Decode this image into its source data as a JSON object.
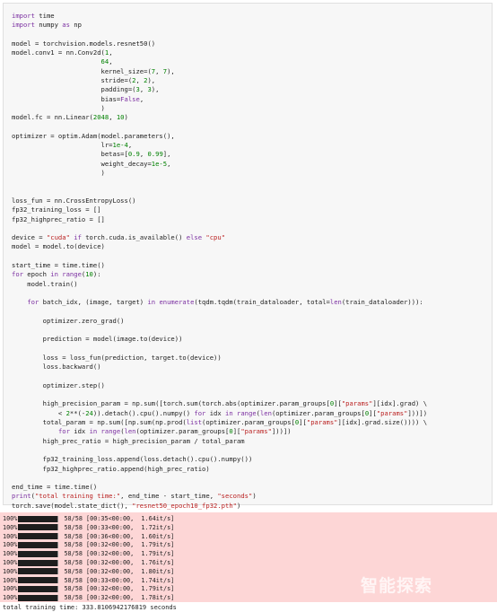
{
  "code_lines": [
    "import time",
    "import numpy as np",
    "",
    "model = torchvision.models.resnet50()",
    "model.conv1 = nn.Conv2d(1,",
    "                       64,",
    "                       kernel_size=(7, 7),",
    "                       stride=(2, 2),",
    "                       padding=(3, 3),",
    "                       bias=False,",
    "                       )",
    "model.fc = nn.Linear(2048, 10)",
    "",
    "optimizer = optim.Adam(model.parameters(),",
    "                       lr=1e-4,",
    "                       betas=[0.9, 0.99],",
    "                       weight_decay=1e-5,",
    "                       )",
    "",
    "",
    "loss_fun = nn.CrossEntropyLoss()",
    "fp32_training_loss = []",
    "fp32_highprec_ratio = []",
    "",
    "device = \"cuda\" if torch.cuda.is_available() else \"cpu\"",
    "model = model.to(device)",
    "",
    "start_time = time.time()",
    "for epoch in range(10):",
    "    model.train()",
    "",
    "    for batch_idx, (image, target) in enumerate(tqdm.tqdm(train_dataloader, total=len(train_dataloader))):",
    "",
    "        optimizer.zero_grad()",
    "",
    "        prediction = model(image.to(device))",
    "",
    "        loss = loss_fun(prediction, target.to(device))",
    "        loss.backward()",
    "",
    "        optimizer.step()",
    "",
    "        high_precision_param = np.sum([torch.sum(torch.abs(optimizer.param_groups[0][\"params\"][idx].grad) \\",
    "            < 2**(-24)).detach().cpu().numpy() for idx in range(len(optimizer.param_groups[0][\"params\"]))])",
    "        total_param = np.sum([np.sum(np.prod(list(optimizer.param_groups[0][\"params\"][idx].grad.size()))) \\",
    "            for idx in range(len(optimizer.param_groups[0][\"params\"]))])",
    "        high_prec_ratio = high_precision_param / total_param",
    "",
    "        fp32_training_loss.append(loss.detach().cpu().numpy())",
    "        fp32_highprec_ratio.append(high_prec_ratio)",
    "",
    "end_time = time.time()",
    "print(\"total training time:\", end_time - start_time, \"seconds\")",
    "torch.save(model.state_dict(), \"resnet50_epoch10_fp32.pth\")"
  ],
  "progress": [
    {
      "pct": "100%",
      "fraction": 1.0,
      "count": "58/58",
      "time": "[00:35<00:00,",
      "rate": "1.64it/s]"
    },
    {
      "pct": "100%",
      "fraction": 1.0,
      "count": "58/58",
      "time": "[00:33<00:00,",
      "rate": "1.72it/s]"
    },
    {
      "pct": "100%",
      "fraction": 1.0,
      "count": "58/58",
      "time": "[00:36<00:00,",
      "rate": "1.60it/s]"
    },
    {
      "pct": "100%",
      "fraction": 1.0,
      "count": "58/58",
      "time": "[00:32<00:00,",
      "rate": "1.79it/s]"
    },
    {
      "pct": "100%",
      "fraction": 1.0,
      "count": "58/58",
      "time": "[00:32<00:00,",
      "rate": "1.79it/s]"
    },
    {
      "pct": "100%",
      "fraction": 1.0,
      "count": "58/58",
      "time": "[00:32<00:00,",
      "rate": "1.76it/s]"
    },
    {
      "pct": "100%",
      "fraction": 1.0,
      "count": "58/58",
      "time": "[00:32<00:00,",
      "rate": "1.80it/s]"
    },
    {
      "pct": "100%",
      "fraction": 1.0,
      "count": "58/58",
      "time": "[00:33<00:00,",
      "rate": "1.74it/s]"
    },
    {
      "pct": "100%",
      "fraction": 1.0,
      "count": "58/58",
      "time": "[00:32<00:00,",
      "rate": "1.79it/s]"
    },
    {
      "pct": "100%",
      "fraction": 1.0,
      "count": "58/58",
      "time": "[00:32<00:00,",
      "rate": "1.78it/s]"
    }
  ],
  "final_output": "total training time: 333.8106942176819 seconds",
  "watermark": "智能探索",
  "colors": {
    "cell_bg": "#f7f7f7",
    "stderr_bg": "#fdd6d6",
    "keyword": "#7b2fa1",
    "string": "#ba2121",
    "number": "#008000",
    "bar_fill": "#1e1e1e"
  }
}
